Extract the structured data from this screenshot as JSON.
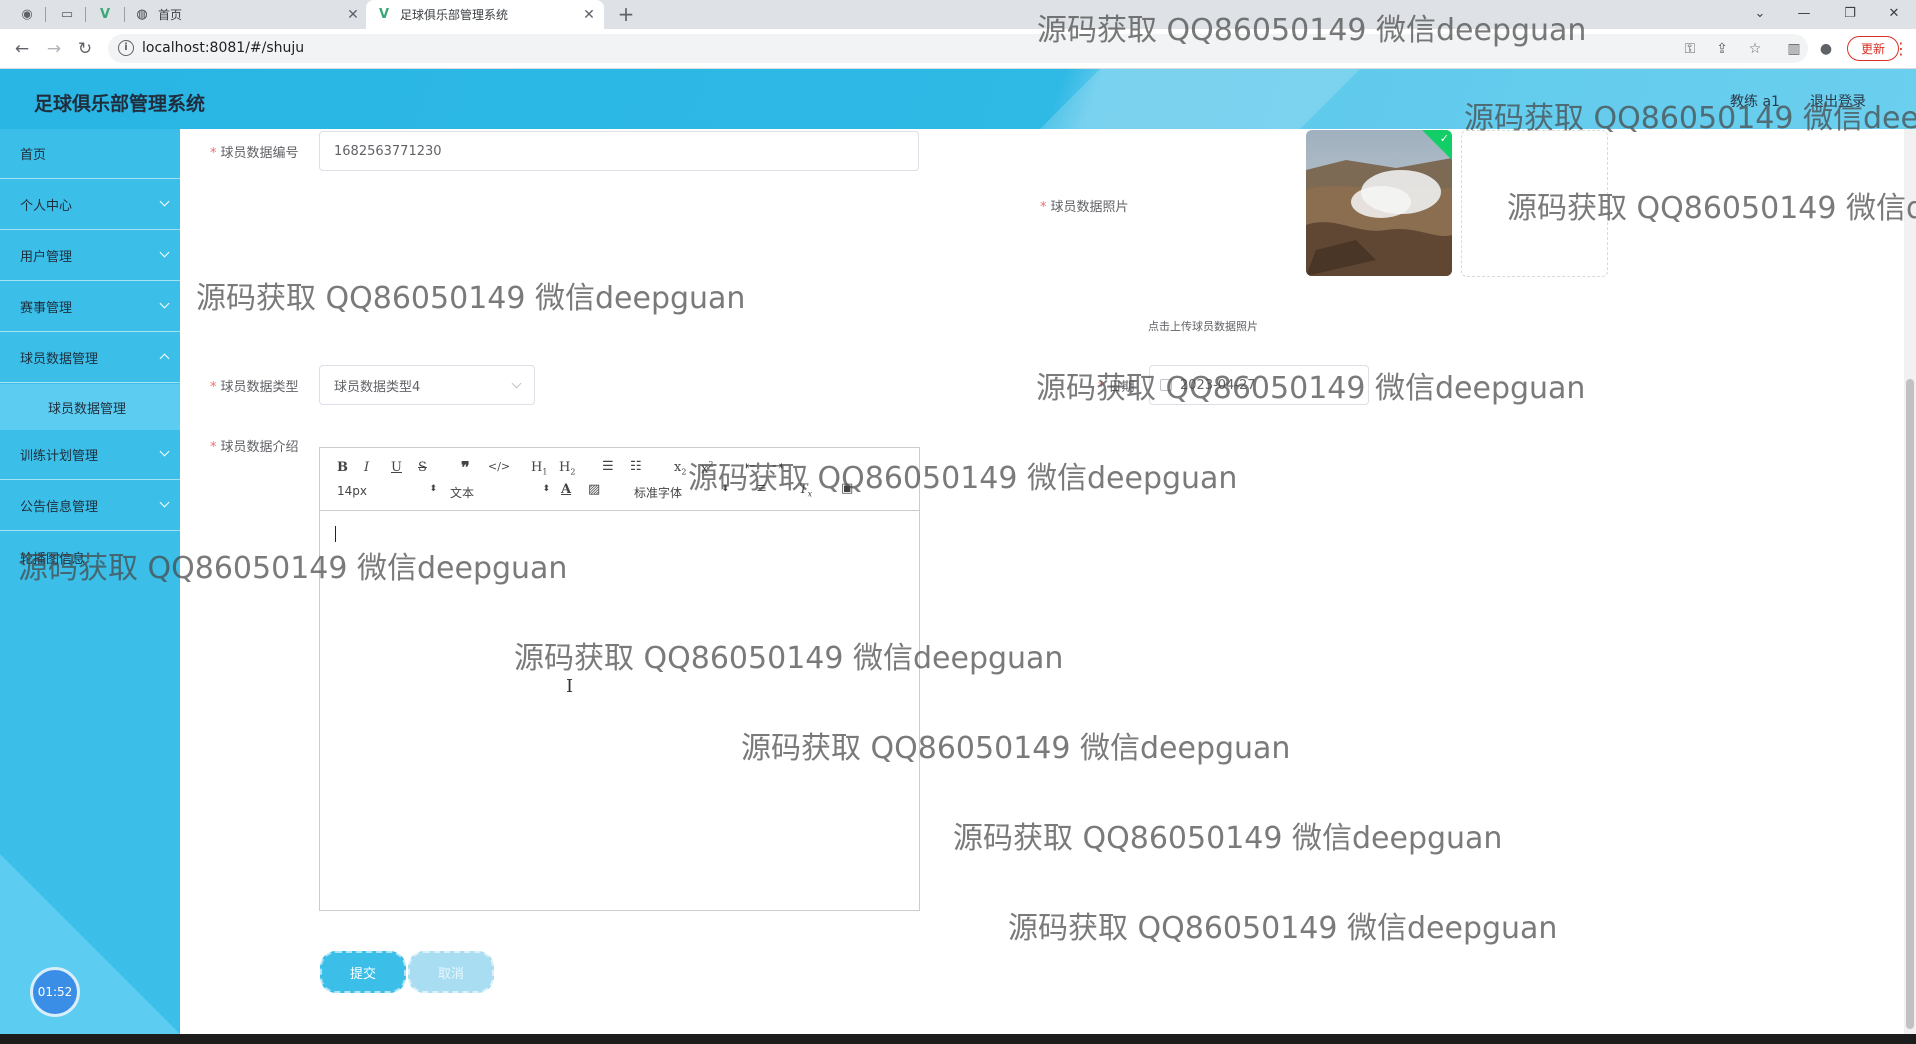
{
  "browser": {
    "tabs": [
      {
        "label": "首页",
        "active": false
      },
      {
        "label": "足球俱乐部管理系统",
        "active": true
      }
    ],
    "url": "localhost:8081/#/shuju",
    "update_label": "更新"
  },
  "header": {
    "title": "足球俱乐部管理系统",
    "user_label": "教练 a1",
    "logout_label": "退出登录"
  },
  "sidebar": {
    "items": [
      {
        "label": "首页"
      },
      {
        "label": "个人中心"
      },
      {
        "label": "用户管理"
      },
      {
        "label": "赛事管理"
      },
      {
        "label": "球员数据管理"
      },
      {
        "label": "训练计划管理"
      },
      {
        "label": "公告信息管理"
      },
      {
        "label": "轮播图信息"
      }
    ],
    "submenu": {
      "label": "球员数据管理"
    },
    "timer": "01:52"
  },
  "form": {
    "number_label": "球员数据编号",
    "number_value": "1682563771230",
    "photo_label": "球员数据照片",
    "upload_tip": "点击上传球员数据照片",
    "type_label": "球员数据类型",
    "type_value": "球员数据类型4",
    "date_label": "日期",
    "date_value": "2023-04-27",
    "intro_label": "球员数据介绍",
    "submit_label": "提交",
    "cancel_label": "取消"
  },
  "editor": {
    "font_size": "14px",
    "block_type": "文本",
    "font_family": "标准字体"
  },
  "watermark": "源码获取 QQ86050149 微信deepguan"
}
